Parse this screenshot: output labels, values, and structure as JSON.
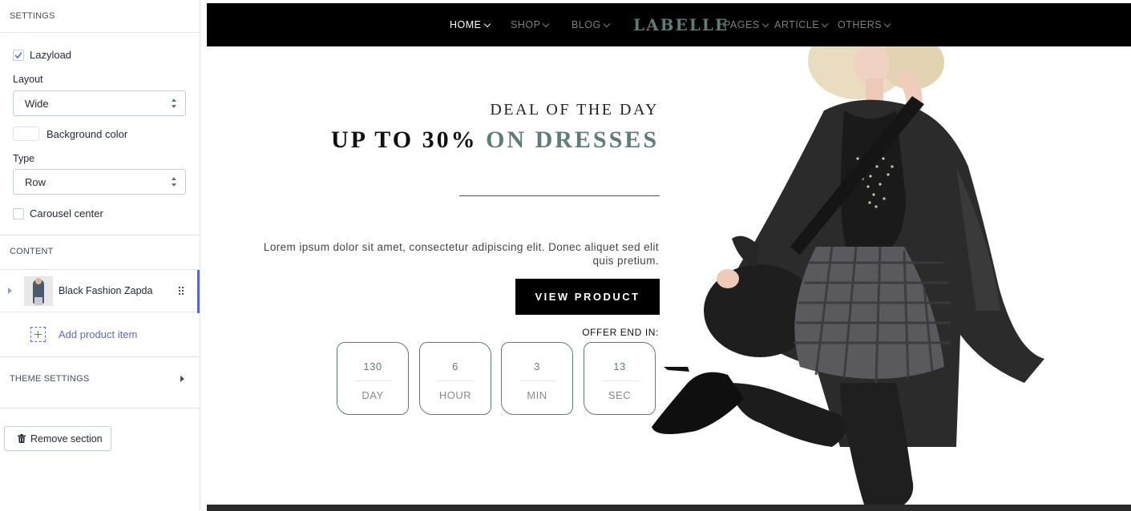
{
  "sidebar": {
    "settings_title": "SETTINGS",
    "lazyload": {
      "label": "Lazyload",
      "checked": true
    },
    "layout": {
      "label": "Layout",
      "value": "Wide"
    },
    "background_color": {
      "label": "Background color",
      "value": "#ffffff"
    },
    "type": {
      "label": "Type",
      "value": "Row"
    },
    "carousel_center": {
      "label": "Carousel center",
      "checked": false
    },
    "content_title": "CONTENT",
    "content_items": [
      {
        "label": "Black Fashion Zapda"
      }
    ],
    "add_item_label": "Add product item",
    "theme_settings_title": "THEME SETTINGS",
    "remove_section_label": "Remove section"
  },
  "preview": {
    "nav": {
      "items_left": [
        {
          "label": "HOME",
          "active": true
        },
        {
          "label": "SHOP",
          "active": false
        },
        {
          "label": "BLOG",
          "active": false
        }
      ],
      "logo": "LABELLE",
      "items_right": [
        {
          "label": "PAGES",
          "active": false
        },
        {
          "label": "ARTICLE",
          "active": false
        },
        {
          "label": "OTHERS",
          "active": false
        }
      ]
    },
    "deal": {
      "subtitle": "DEAL OF THE DAY",
      "headline_part1": "UP TO 30%",
      "headline_part2": "ON DRESSES",
      "description": "Lorem ipsum dolor sit amet, consectetur adipiscing elit. Donec aliquet sed elit quis pretium.",
      "button_label": "VIEW PRODUCT",
      "offer_label": "OFFER END IN:",
      "countdown": [
        {
          "value": "130",
          "unit": "DAY"
        },
        {
          "value": "6",
          "unit": "HOUR"
        },
        {
          "value": "3",
          "unit": "MIN"
        },
        {
          "value": "13",
          "unit": "SEC"
        }
      ]
    }
  },
  "colors": {
    "accent": "#5e7d78",
    "sidebar_link": "#5c6ac4",
    "nav_bg": "#000000"
  },
  "icons": {
    "lazyload_checkbox": "check-icon",
    "add_item": "add-square-icon",
    "remove": "trash-icon",
    "content_drag": "drag-handle-icon",
    "content_expand": "caret-right-icon",
    "theme_expand": "caret-right-icon",
    "select_arrows": "select-arrows-icon",
    "nav_dropdown": "chevron-down-icon"
  }
}
